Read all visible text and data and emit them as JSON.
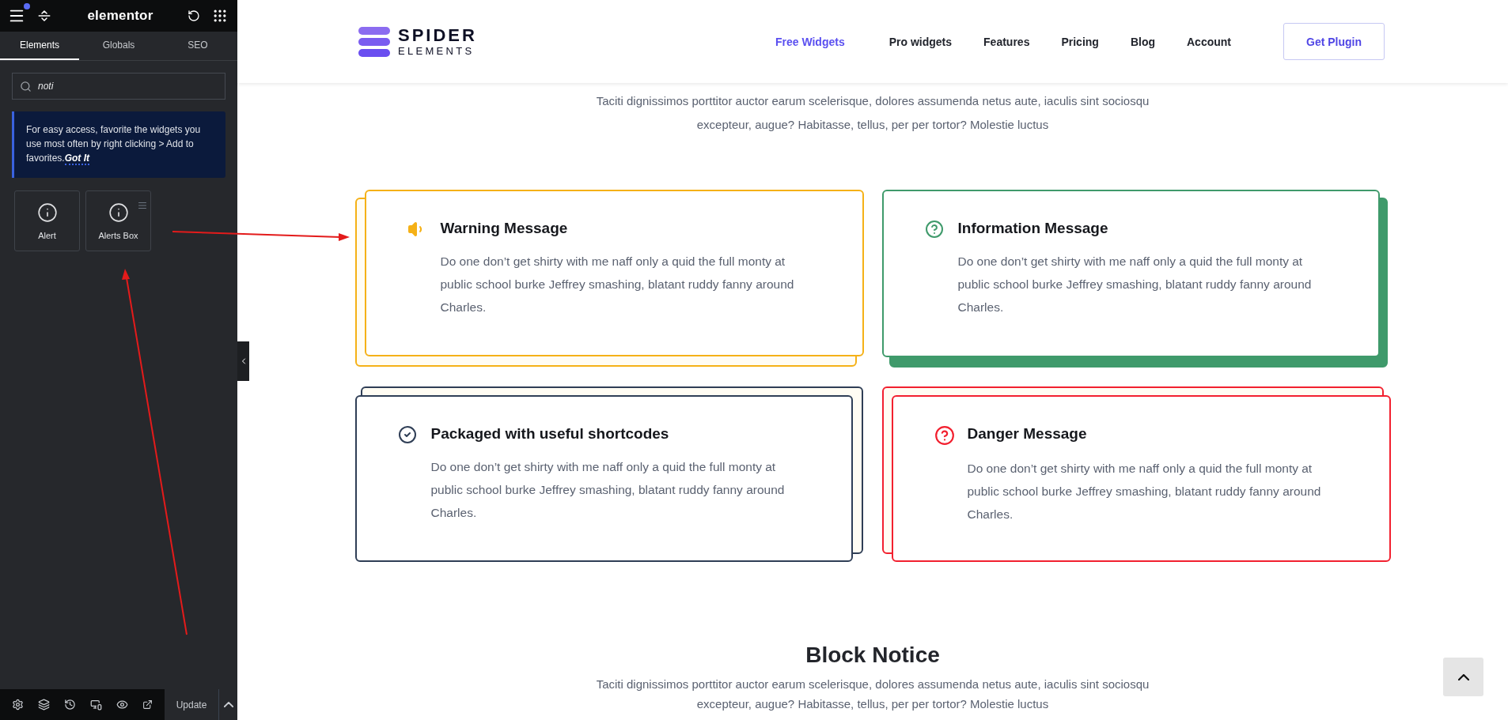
{
  "editor": {
    "title": "elementor",
    "menu_notification": true,
    "tabs": [
      {
        "label": "Elements",
        "selected": true
      },
      {
        "label": "Globals",
        "selected": false
      },
      {
        "label": "SEO",
        "selected": false
      }
    ],
    "search": {
      "value": "noti"
    },
    "notice": {
      "text": "For easy access, favorite the widgets you use most often by right clicking > Add to favorites.",
      "link": "Got It"
    },
    "widgets": [
      {
        "label": "Alert",
        "handle": false
      },
      {
        "label": "Alerts Box",
        "handle": true
      }
    ],
    "footer": {
      "update_button": "Update"
    }
  },
  "site": {
    "logo": {
      "line1": "SPIDER",
      "line2": "ELEMENTS"
    },
    "nav": [
      {
        "label": "Free Widgets",
        "selected": true
      },
      {
        "label": "Pro widgets",
        "selected": false
      },
      {
        "label": "Features",
        "selected": false
      },
      {
        "label": "Pricing",
        "selected": false
      },
      {
        "label": "Blog",
        "selected": false
      },
      {
        "label": "Account",
        "selected": false
      }
    ],
    "cta": "Get Plugin",
    "intro": "Taciti dignissimos porttitor auctor earum scelerisque, dolores assumenda netus aute, iaculis sint sociosqu excepteur, augue? Habitasse, tellus, per per tortor? Molestie luctus",
    "cards": [
      {
        "kind": "warning",
        "color": "#f5b117",
        "title": "Warning Message",
        "body": "Do one don’t get shirty with me naff only a quid the full monty at public school burke Jeffrey smashing, blatant ruddy fanny around Charles."
      },
      {
        "kind": "info",
        "color": "#3f9a6b",
        "title": "Information Message",
        "body": "Do one don’t get shirty with me naff only a quid the full monty at public school burke Jeffrey smashing, blatant ruddy fanny around Charles."
      },
      {
        "kind": "success",
        "color": "#2f3e56",
        "title": "Packaged with useful shortcodes",
        "body": "Do one don’t get shirty with me naff only a quid the full monty at public school burke Jeffrey smashing, blatant ruddy fanny around Charles."
      },
      {
        "kind": "danger",
        "color": "#f2202f",
        "title": "Danger Message",
        "body": "Do one don’t get shirty with me naff only a quid the full monty at public school burke Jeffrey smashing, blatant ruddy fanny around Charles."
      }
    ],
    "section_title": "Block Notice",
    "section_text": "Taciti dignissimos porttitor auctor earum scelerisque, dolores assumenda netus aute, iaculis sint sociosqu excepteur, augue? Habitasse, tellus, per per tortor? Molestie luctus"
  }
}
